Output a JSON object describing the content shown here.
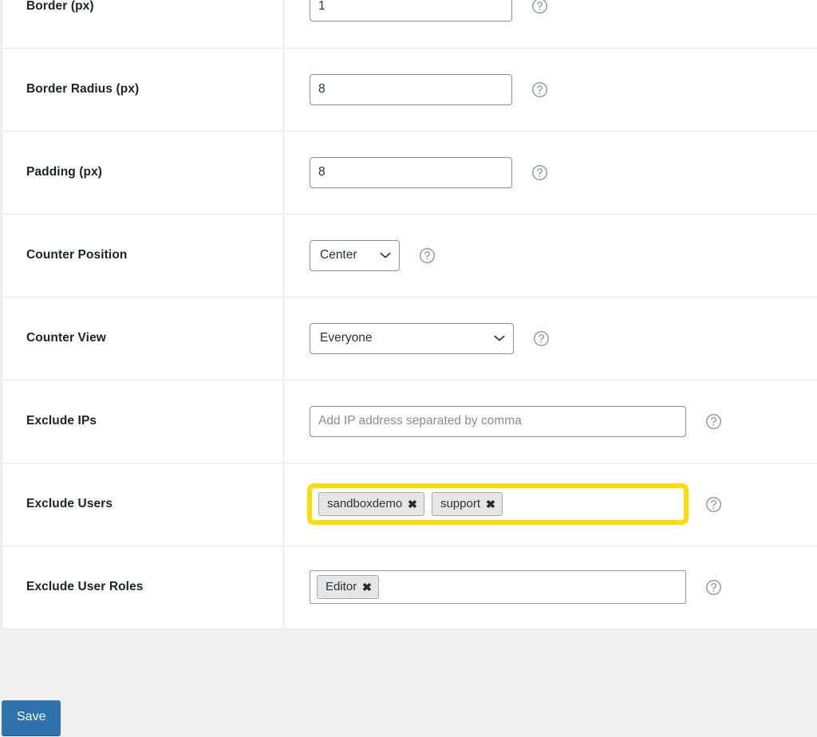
{
  "colors": {
    "accent_blue": "#2e73ae",
    "highlight_yellow": "#ffdd00",
    "page_background": "#f0f0f1",
    "label_text": "#1d2327",
    "input_border": "#8c8f94"
  },
  "settings_rows": [
    {
      "label": "Border (px)",
      "control": "text",
      "value": "1",
      "placeholder": "",
      "help": "help-icon"
    },
    {
      "label": "Border Radius (px)",
      "control": "text",
      "value": "8",
      "placeholder": "",
      "help": "help-icon"
    },
    {
      "label": "Padding (px)",
      "control": "text",
      "value": "8",
      "placeholder": "",
      "help": "help-icon"
    },
    {
      "label": "Counter Position",
      "control": "select",
      "value": "Center",
      "help": "help-icon"
    },
    {
      "label": "Counter View",
      "control": "select",
      "value": "Everyone",
      "help": "help-icon"
    },
    {
      "label": "Exclude IPs",
      "control": "text",
      "value": "",
      "placeholder": "Add IP address separated by comma",
      "help": "help-icon"
    },
    {
      "label": "Exclude Users",
      "control": "tokens",
      "tokens": [
        "sandboxdemo",
        "support"
      ],
      "highlighted": true,
      "help": "help-icon"
    },
    {
      "label": "Exclude User Roles",
      "control": "tokens",
      "tokens": [
        "Editor"
      ],
      "highlighted": false,
      "help": "help-icon"
    }
  ],
  "token_remove_glyph": "✖",
  "footer": {
    "save_label": "Save"
  }
}
